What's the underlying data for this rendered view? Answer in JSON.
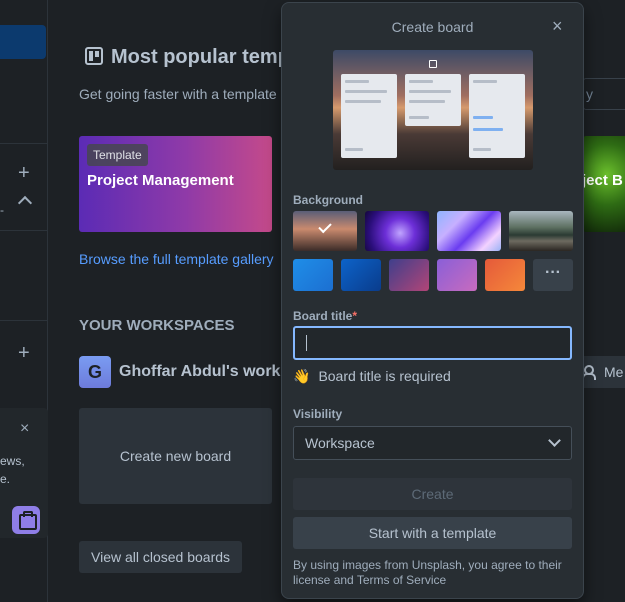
{
  "sidebar": {
    "popup_close": "×",
    "popup_text_1": "ews,",
    "popup_text_2": "e."
  },
  "main": {
    "section_title": "Most popular temp",
    "section_subtitle": "Get going faster with a template",
    "template_card": {
      "badge": "Template",
      "name": "Project Management"
    },
    "browse_link": "Browse the full template gallery",
    "workspaces_heading": "YOUR WORKSPACES",
    "workspace": {
      "initial": "G",
      "name": "Ghoffar Abdul's work"
    },
    "create_new_board": "Create new board",
    "view_closed": "View all closed boards"
  },
  "right_peek": {
    "search_placeholder": "y",
    "card_text": "roject B",
    "members_label": "Me"
  },
  "popover": {
    "title": "Create board",
    "close": "×",
    "background_label": "Background",
    "more_label": "···",
    "board_title_label": "Board title",
    "required_mark": "*",
    "board_title_value": "",
    "hint_emoji": "👋",
    "hint_text": "Board title is required",
    "visibility_label": "Visibility",
    "visibility_value": "Workspace",
    "create_label": "Create",
    "template_label": "Start with a template",
    "legal": "By using images from Unsplash, you agree to their license and Terms of Service"
  },
  "colors": {
    "page_bg": "#1d2125",
    "popover_bg": "#282e33",
    "accent_link": "#579dff",
    "input_focus": "#85b8ff",
    "required": "#f87168"
  }
}
